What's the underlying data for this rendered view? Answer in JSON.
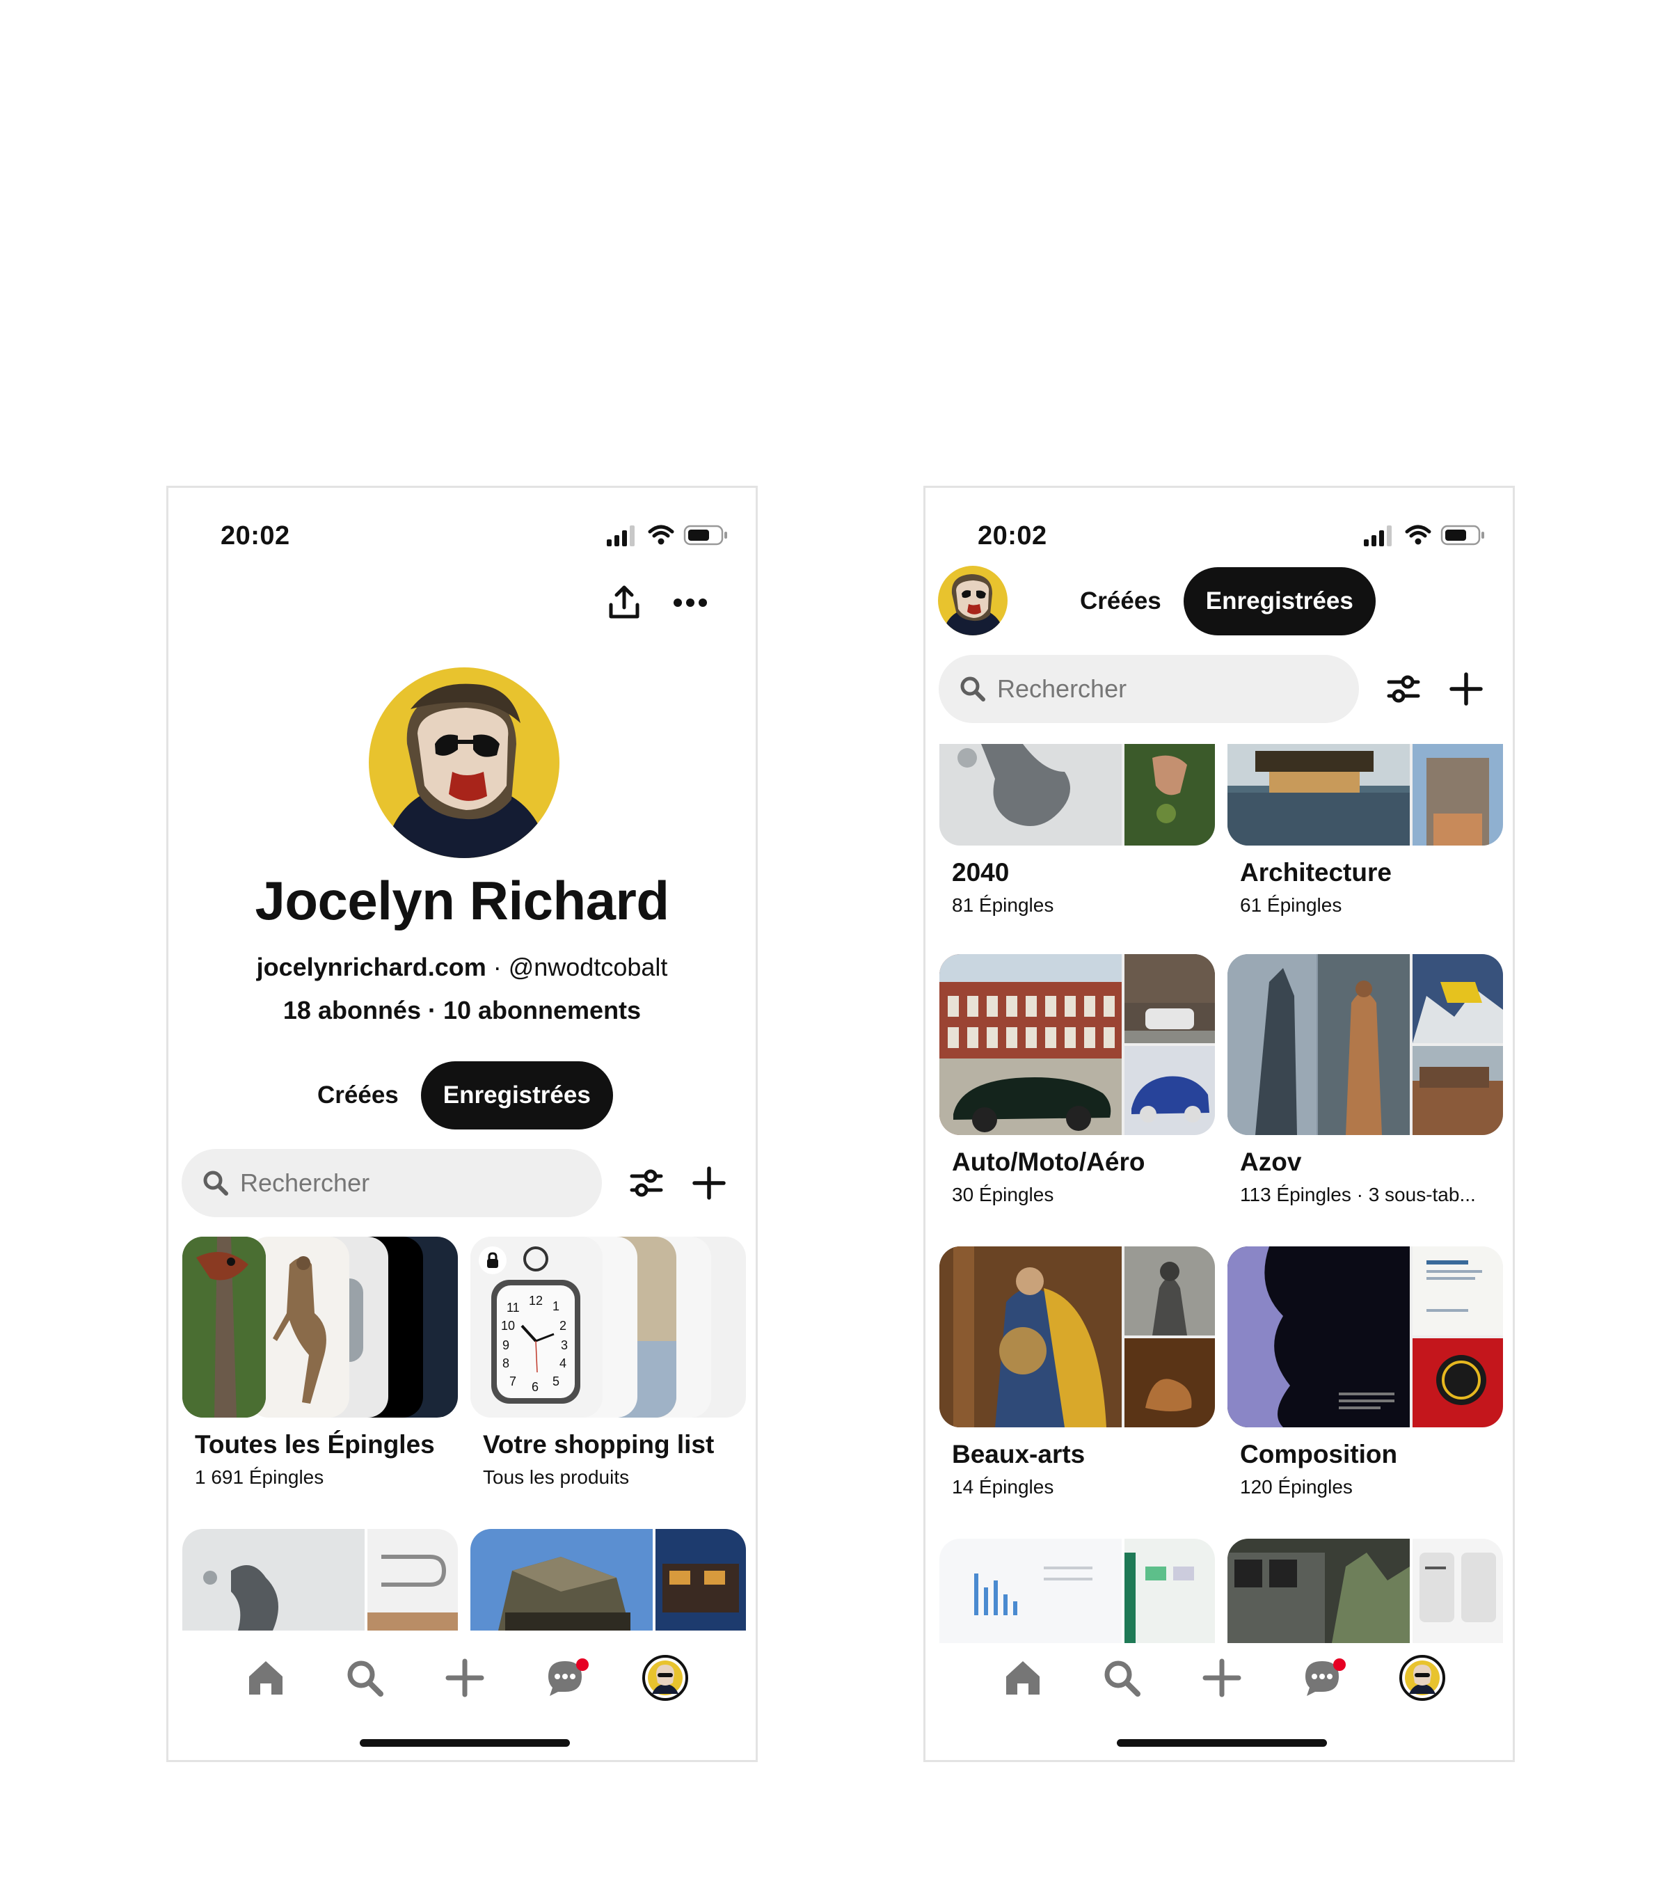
{
  "status": {
    "time": "20:02"
  },
  "profile": {
    "name": "Jocelyn Richard",
    "website": "jocelynrichard.com",
    "separator": " · ",
    "handle": "@nwodtcobalt",
    "followers": "18 abonnés",
    "following": "10 abonnements"
  },
  "tabs": {
    "created": "Créées",
    "saved": "Enregistrées"
  },
  "search": {
    "placeholder": "Rechercher"
  },
  "left_boards": [
    {
      "name": "Toutes les Épingles",
      "meta": "1 691 Épingles"
    },
    {
      "name": "Votre shopping list",
      "meta": "Tous les produits"
    }
  ],
  "clock_face": {
    "numbers": [
      "12",
      "1",
      "2",
      "3",
      "4",
      "5",
      "6",
      "7",
      "8",
      "9",
      "10",
      "11"
    ]
  },
  "right_boards": [
    {
      "name": "2040",
      "meta": "81 Épingles"
    },
    {
      "name": "Architecture",
      "meta": "61 Épingles"
    },
    {
      "name": "Auto/Moto/Aéro",
      "meta": "30 Épingles"
    },
    {
      "name": "Azov",
      "meta": "113 Épingles · 3 sous-tab..."
    },
    {
      "name": "Beaux-arts",
      "meta": "14 Épingles"
    },
    {
      "name": "Composition",
      "meta": "120 Épingles"
    }
  ],
  "nav": {
    "icons": [
      "home-icon",
      "search-icon",
      "add-icon",
      "messages-icon",
      "profile-avatar"
    ],
    "notification_color": "#e60023"
  },
  "colors": {
    "accent": "#111111",
    "search_bg": "#efefef",
    "avatar_bg": "#e8c32e"
  }
}
